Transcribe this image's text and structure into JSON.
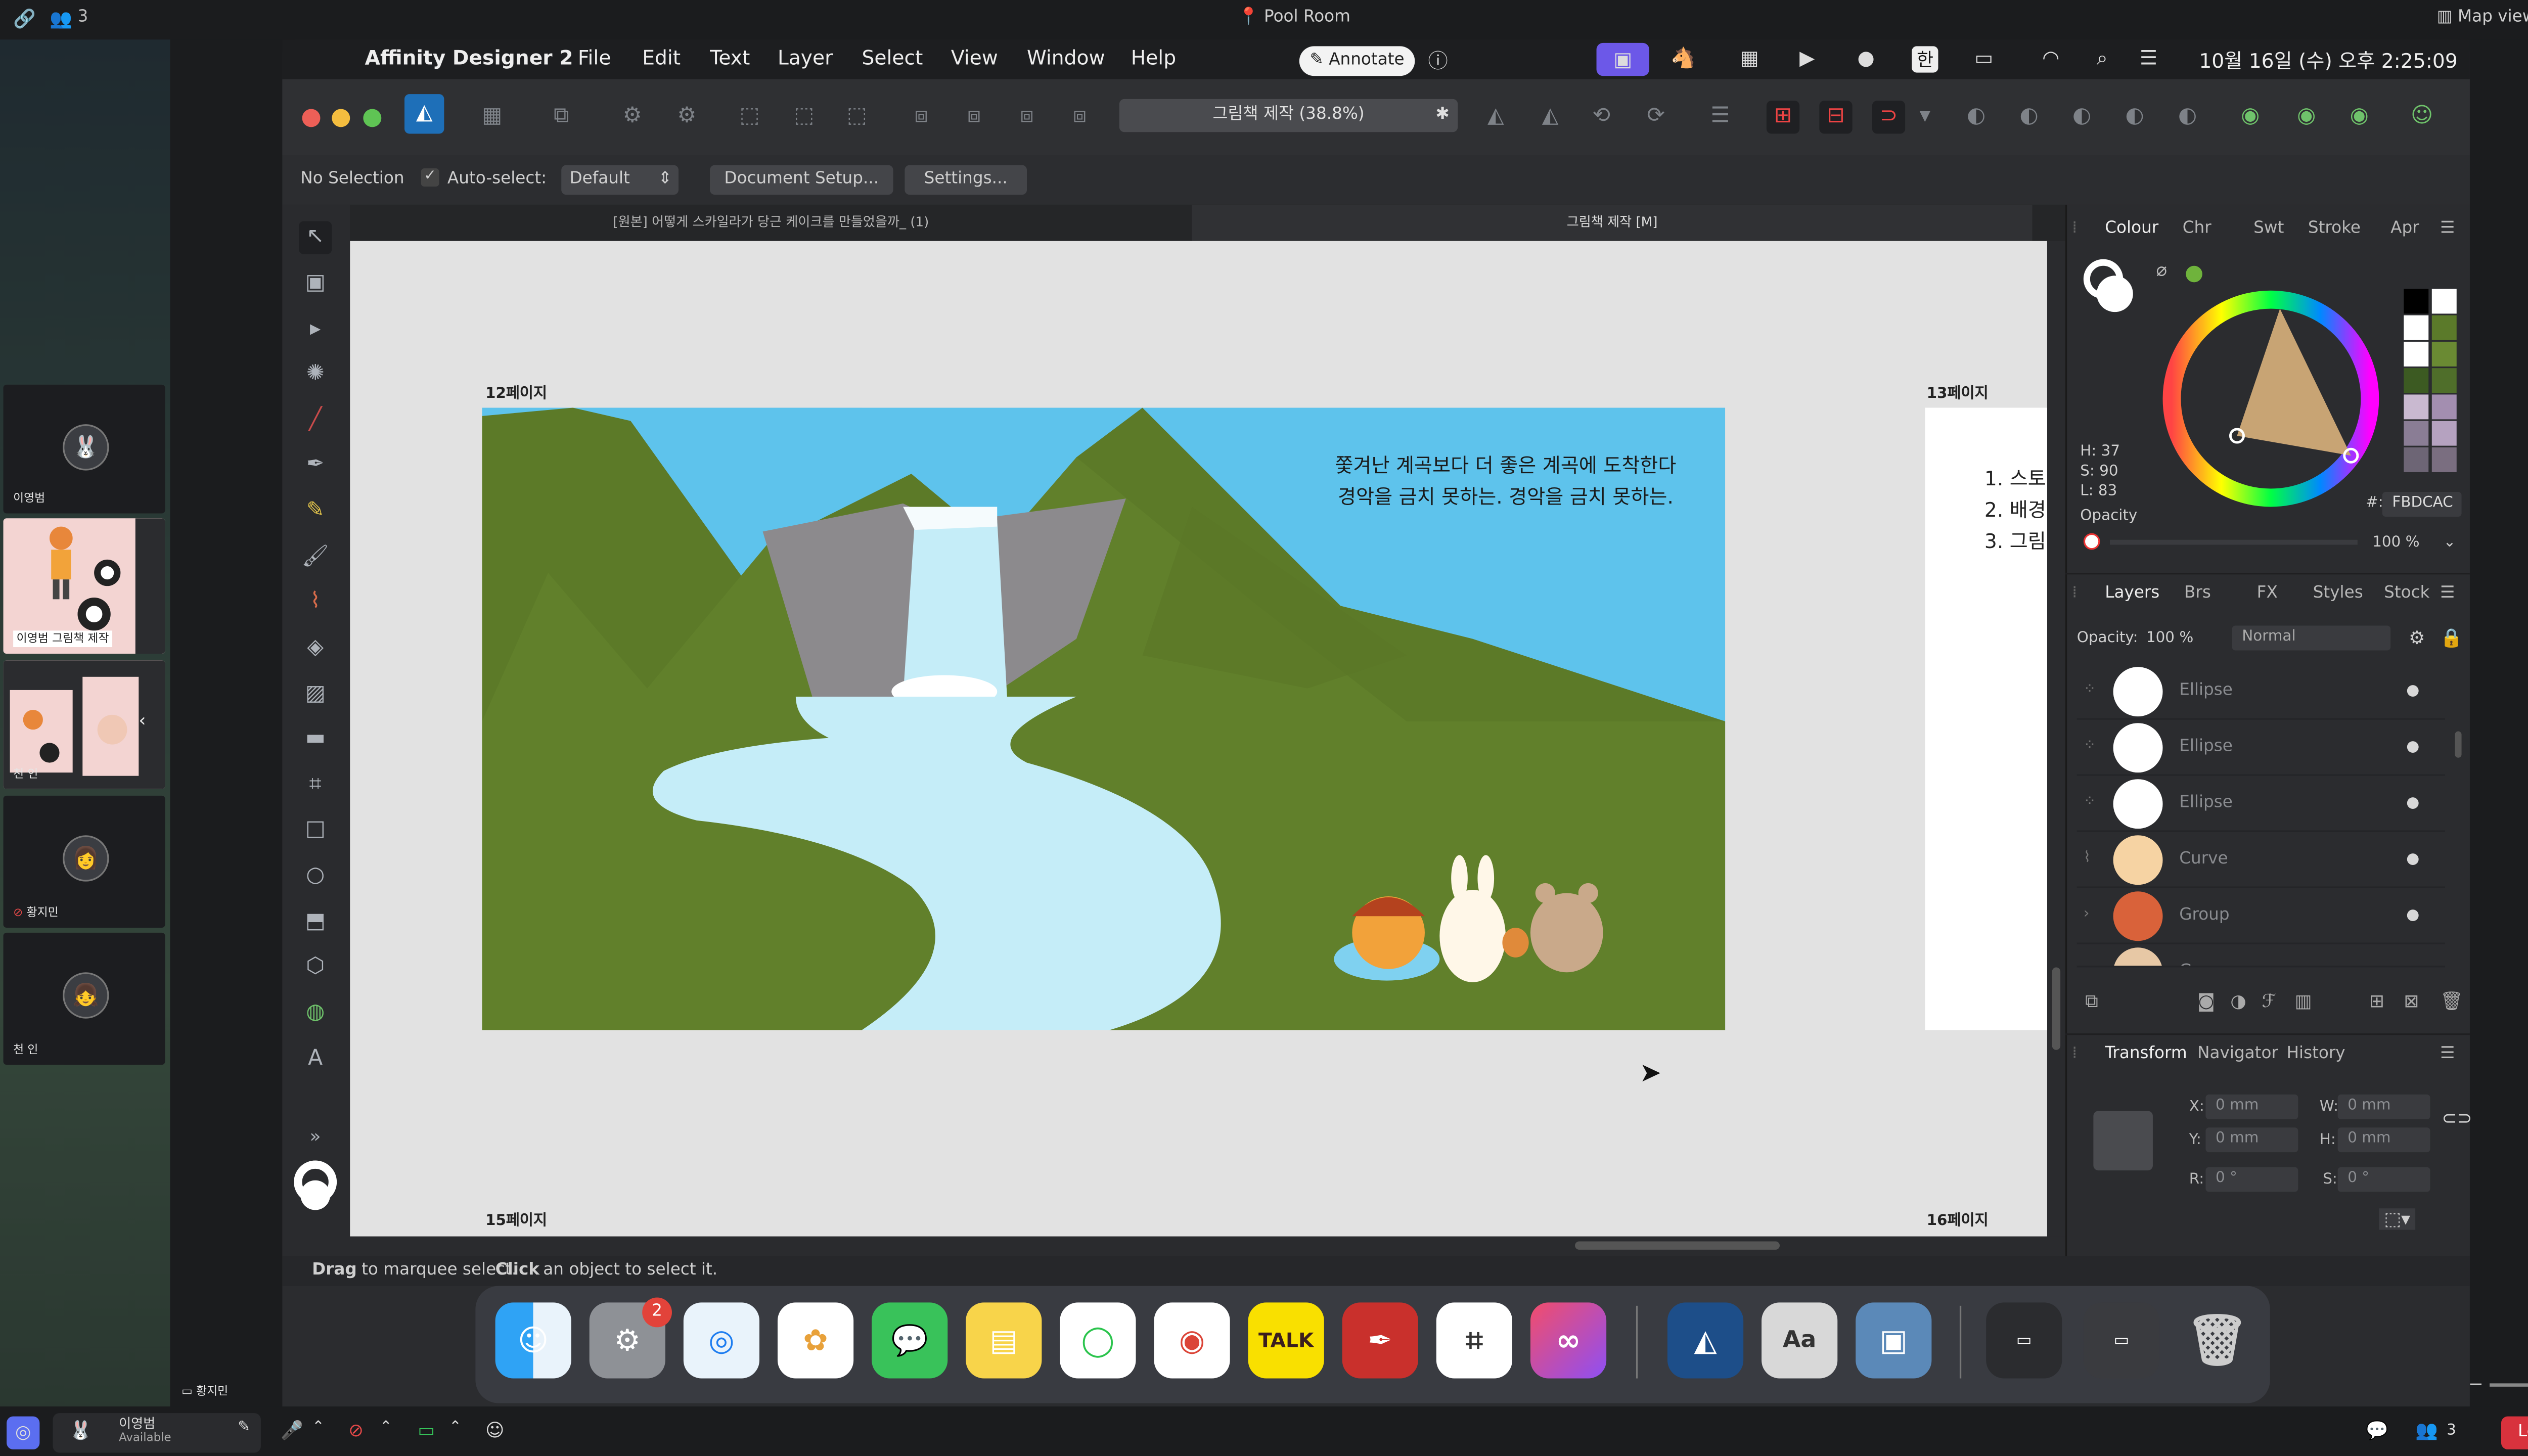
{
  "meeting": {
    "participant_count": "3",
    "room_name": "Pool Room",
    "map_view_label": "Map view",
    "participants": [
      {
        "name": "이영범"
      },
      {
        "name": "이영범",
        "caption": "그림책 제작"
      },
      {
        "name": "천 인"
      },
      {
        "name": "황지민"
      },
      {
        "name": "천 인"
      }
    ],
    "self_name": "이영범",
    "self_status": "Available",
    "bottom_label": "황지민",
    "leave_label": "Leave",
    "people_count": "3"
  },
  "menubar": {
    "app_name": "Affinity Designer 2",
    "items": [
      "File",
      "Edit",
      "Text",
      "Layer",
      "Select",
      "View",
      "Window",
      "Help"
    ],
    "annotate_label": "Annotate",
    "ime_label": "한",
    "clock": "10월 16일 (수) 오후 2:25:09"
  },
  "toolbar": {
    "document_title": "그림책 제작 (38.8%)"
  },
  "context_toolbar": {
    "selection": "No Selection",
    "auto_select_label": "Auto-select:",
    "auto_select_value": "Default",
    "document_setup_label": "Document Setup...",
    "settings_label": "Settings..."
  },
  "tabs": [
    {
      "label": "[원본] 어떻게 스카일라가 당근 케이크를 만들었을까_ (1)",
      "active": false
    },
    {
      "label": "그림책 제작 [M]",
      "active": true
    }
  ],
  "canvas": {
    "page_labels": {
      "p12": "12페이지",
      "p13": "13페이지",
      "p15": "15페이지",
      "p16": "16페이지"
    },
    "story_text_line1": "쫓겨난 계곡보다 더 좋은 계곡에 도착한다",
    "story_text_line2": "경악을 금치 못하는. 경악을 금치 못하는.",
    "right_page_lines": [
      "1. 스토",
      "2. 배경",
      "3. 그림"
    ]
  },
  "colour_panel": {
    "tabs": [
      "Colour",
      "Chr",
      "Swt",
      "Stroke",
      "Apr"
    ],
    "h": "H: 37",
    "s": "S: 90",
    "l": "L: 83",
    "hex_label": "#:",
    "hex_value": "FBDCAC",
    "opacity_label": "Opacity",
    "opacity_value": "100 %",
    "swatches": [
      "#000000",
      "#ffffff",
      "#ffffff",
      "#5b7a2a",
      "#ffffff",
      "#6a8a33",
      "#3c5a22",
      "#4f6e2a",
      "#c9b9d0",
      "#a38eb0",
      "#8a7d95",
      "#b5a2c0",
      "#6d6575",
      "#7a6e80"
    ]
  },
  "layers_panel": {
    "tabs": [
      "Layers",
      "Brs",
      "FX",
      "Styles",
      "Stock"
    ],
    "opacity_label": "Opacity:",
    "opacity_value": "100 %",
    "blend_mode": "Normal",
    "layers": [
      {
        "name": "Ellipse",
        "thumb": "#ffffff"
      },
      {
        "name": "Ellipse",
        "thumb": "#ffffff"
      },
      {
        "name": "Ellipse",
        "thumb": "#ffffff"
      },
      {
        "name": "Curve",
        "thumb": "#f6d3a3"
      },
      {
        "name": "Group",
        "thumb": "#d9623a"
      },
      {
        "name": "Group",
        "thumb": "#e7c8a5"
      }
    ]
  },
  "transform_panel": {
    "tabs": [
      "Transform",
      "Navigator",
      "History"
    ],
    "x_label": "X:",
    "x_value": "0 mm",
    "y_label": "Y:",
    "y_value": "0 mm",
    "w_label": "W:",
    "w_value": "0 mm",
    "h_label": "H:",
    "h_value": "0 mm",
    "r_label": "R:",
    "r_value": "0 °",
    "s_label": "S:",
    "s_value": "0 °"
  },
  "status": {
    "drag_bold": "Drag",
    "drag_text": "to marquee select.",
    "click_bold": "Click",
    "click_text": "an object to select it."
  },
  "dock": {
    "badge_count": "2",
    "talk_label": "TALK"
  }
}
